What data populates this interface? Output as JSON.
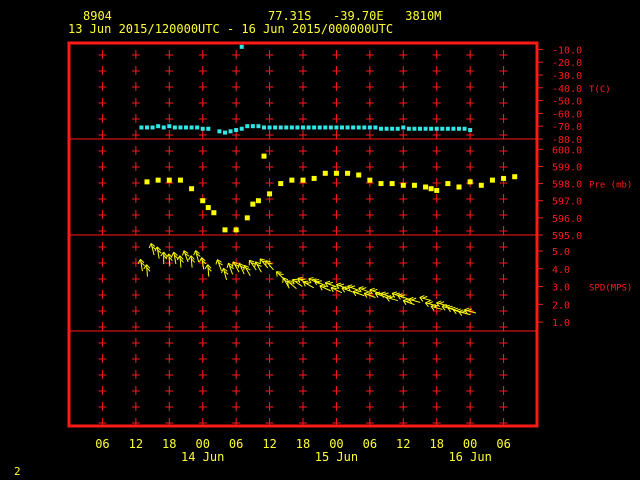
{
  "header": {
    "station_id": "8904",
    "location": "77.31S   -39.70E   3810M",
    "time_range": "13 Jun 2015/120000UTC - 16 Jun 2015/000000UTC"
  },
  "page_number": "2",
  "colors": {
    "frame": "#ff1a1a",
    "grid": "#ff1a1a",
    "text": "#ffff33",
    "temperature": "#33e6e6",
    "pressure": "#ffff00",
    "wind": "#ffff00",
    "background": "#000000"
  },
  "chart_data": {
    "type": "scatter",
    "x_ticks": [
      "06",
      "12",
      "18",
      "00",
      "06",
      "12",
      "18",
      "00",
      "06",
      "12",
      "18",
      "00",
      "06"
    ],
    "x_tick_hours": [
      -6,
      0,
      6,
      12,
      18,
      24,
      30,
      36,
      42,
      48,
      54,
      60,
      66
    ],
    "x_range_hours": [
      -12,
      72
    ],
    "date_labels": [
      {
        "text": "14 Jun",
        "hour": 12
      },
      {
        "text": "15 Jun",
        "hour": 36
      },
      {
        "text": "16 Jun",
        "hour": 60
      }
    ],
    "panels": [
      {
        "name": "temperature",
        "label": "T(C)",
        "label_value": -40.0,
        "range": [
          -80,
          -5
        ],
        "ticks": [
          -10.0,
          -20.0,
          -30.0,
          -40.0,
          -50.0,
          -60.0,
          -70.0,
          -80.0
        ],
        "tick_labels": [
          "-10.0",
          "-20.0",
          "-30.0",
          "-40.0",
          "-50.0",
          "-60.0",
          "-70.0",
          "-80.0"
        ],
        "points": [
          [
            1,
            -71
          ],
          [
            2,
            -71
          ],
          [
            3,
            -71
          ],
          [
            4,
            -70
          ],
          [
            5,
            -71
          ],
          [
            6,
            -70
          ],
          [
            7,
            -71
          ],
          [
            8,
            -71
          ],
          [
            9,
            -71
          ],
          [
            10,
            -71
          ],
          [
            11,
            -71
          ],
          [
            12,
            -72
          ],
          [
            13,
            -72
          ],
          [
            15,
            -74
          ],
          [
            16,
            -75
          ],
          [
            17,
            -74
          ],
          [
            18,
            -73
          ],
          [
            19,
            -72
          ],
          [
            20,
            -70
          ],
          [
            21,
            -70
          ],
          [
            22,
            -70
          ],
          [
            23,
            -71
          ],
          [
            24,
            -71
          ],
          [
            25,
            -71
          ],
          [
            26,
            -71
          ],
          [
            27,
            -71
          ],
          [
            28,
            -71
          ],
          [
            29,
            -71
          ],
          [
            30,
            -71
          ],
          [
            31,
            -71
          ],
          [
            32,
            -71
          ],
          [
            33,
            -71
          ],
          [
            34,
            -71
          ],
          [
            35,
            -71
          ],
          [
            36,
            -71
          ],
          [
            37,
            -71
          ],
          [
            38,
            -71
          ],
          [
            39,
            -71
          ],
          [
            40,
            -71
          ],
          [
            41,
            -71
          ],
          [
            42,
            -71
          ],
          [
            43,
            -71
          ],
          [
            44,
            -72
          ],
          [
            45,
            -72
          ],
          [
            46,
            -72
          ],
          [
            47,
            -72
          ],
          [
            48,
            -71
          ],
          [
            49,
            -72
          ],
          [
            50,
            -72
          ],
          [
            51,
            -72
          ],
          [
            52,
            -72
          ],
          [
            53,
            -72
          ],
          [
            54,
            -72
          ],
          [
            55,
            -72
          ],
          [
            56,
            -72
          ],
          [
            57,
            -72
          ],
          [
            58,
            -72
          ],
          [
            59,
            -72
          ],
          [
            60,
            -73
          ]
        ],
        "outliers": [
          [
            19,
            -8
          ]
        ]
      },
      {
        "name": "pressure",
        "label": "Pre (mb)",
        "label_value": 598.0,
        "range": [
          595,
          600.6
        ],
        "ticks": [
          600.0,
          599.0,
          598.0,
          597.0,
          596.0,
          595.0
        ],
        "tick_labels": [
          "600.0",
          "599.0",
          "598.0",
          "597.0",
          "596.0",
          "595.0"
        ],
        "points": [
          [
            2,
            598.1
          ],
          [
            4,
            598.2
          ],
          [
            6,
            598.2
          ],
          [
            8,
            598.2
          ],
          [
            10,
            597.7
          ],
          [
            12,
            597.0
          ],
          [
            13,
            596.6
          ],
          [
            14,
            596.3
          ],
          [
            16,
            595.3
          ],
          [
            18,
            595.3
          ],
          [
            20,
            596.0
          ],
          [
            21,
            596.8
          ],
          [
            22,
            597.0
          ],
          [
            24,
            597.4
          ],
          [
            26,
            598.0
          ],
          [
            28,
            598.2
          ],
          [
            30,
            598.2
          ],
          [
            32,
            598.3
          ],
          [
            34,
            598.6
          ],
          [
            36,
            598.6
          ],
          [
            38,
            598.6
          ],
          [
            40,
            598.5
          ],
          [
            42,
            598.2
          ],
          [
            44,
            598.0
          ],
          [
            46,
            598.0
          ],
          [
            48,
            597.9
          ],
          [
            50,
            597.9
          ],
          [
            52,
            597.8
          ],
          [
            53,
            597.7
          ],
          [
            54,
            597.6
          ],
          [
            56,
            598.0
          ],
          [
            58,
            597.8
          ],
          [
            60,
            598.1
          ],
          [
            62,
            597.9
          ],
          [
            64,
            598.2
          ],
          [
            66,
            598.3
          ],
          [
            68,
            598.4
          ]
        ],
        "outliers": [
          [
            23,
            599.6
          ]
        ]
      },
      {
        "name": "wind_speed",
        "label": "SPD(MPS)",
        "label_value": 3.0,
        "range": [
          0.5,
          5.9
        ],
        "ticks": [
          5.0,
          4.0,
          3.0,
          2.0,
          1.0
        ],
        "tick_labels": [
          "5.0",
          "4.0",
          "3.0",
          "2.0",
          "1.0"
        ],
        "points": [
          [
            1,
            4.2
          ],
          [
            2,
            3.9
          ],
          [
            3,
            5.1
          ],
          [
            4,
            4.9
          ],
          [
            5,
            4.6
          ],
          [
            6,
            4.5
          ],
          [
            7,
            4.6
          ],
          [
            8,
            4.4
          ],
          [
            9,
            4.7
          ],
          [
            10,
            4.4
          ],
          [
            11,
            4.7
          ],
          [
            12,
            4.3
          ],
          [
            13,
            3.9
          ],
          [
            15,
            4.2
          ],
          [
            16,
            3.7
          ],
          [
            17,
            4.0
          ],
          [
            18,
            4.1
          ],
          [
            19,
            4.0
          ],
          [
            20,
            3.9
          ],
          [
            21,
            4.2
          ],
          [
            22,
            4.1
          ],
          [
            23,
            4.3
          ],
          [
            24,
            4.2
          ],
          [
            26,
            3.6
          ],
          [
            27,
            3.2
          ],
          [
            28,
            3.1
          ],
          [
            29,
            3.2
          ],
          [
            30,
            3.3
          ],
          [
            31,
            3.1
          ],
          [
            32,
            3.3
          ],
          [
            33,
            3.2
          ],
          [
            34,
            2.9
          ],
          [
            35,
            3.1
          ],
          [
            36,
            2.8
          ],
          [
            37,
            3.0
          ],
          [
            38,
            2.8
          ],
          [
            39,
            2.9
          ],
          [
            40,
            2.6
          ],
          [
            41,
            2.8
          ],
          [
            42,
            2.5
          ],
          [
            43,
            2.7
          ],
          [
            44,
            2.5
          ],
          [
            45,
            2.5
          ],
          [
            46,
            2.3
          ],
          [
            47,
            2.5
          ],
          [
            48,
            2.4
          ],
          [
            49,
            2.1
          ],
          [
            50,
            2.2
          ],
          [
            52,
            2.3
          ],
          [
            53,
            2.0
          ],
          [
            54,
            1.8
          ],
          [
            55,
            2.0
          ],
          [
            56,
            1.8
          ],
          [
            57,
            1.7
          ],
          [
            58,
            1.6
          ],
          [
            59,
            1.5
          ],
          [
            60,
            1.6
          ]
        ],
        "directions_deg": [
          170,
          175,
          165,
          170,
          180,
          175,
          170,
          175,
          160,
          175,
          165,
          170,
          175,
          160,
          165,
          160,
          150,
          155,
          150,
          145,
          150,
          140,
          140,
          135,
          150,
          130,
          125,
          120,
          120,
          115,
          115,
          115,
          110,
          115,
          110,
          110,
          110,
          110,
          110,
          110,
          110,
          110,
          110,
          105,
          110,
          110,
          110,
          105,
          105,
          105,
          105,
          105,
          105,
          110,
          105,
          105,
          105
        ]
      },
      {
        "name": "lower",
        "label": "",
        "range": [
          0,
          1
        ],
        "ticks": [],
        "tick_labels": [],
        "points": []
      }
    ]
  }
}
